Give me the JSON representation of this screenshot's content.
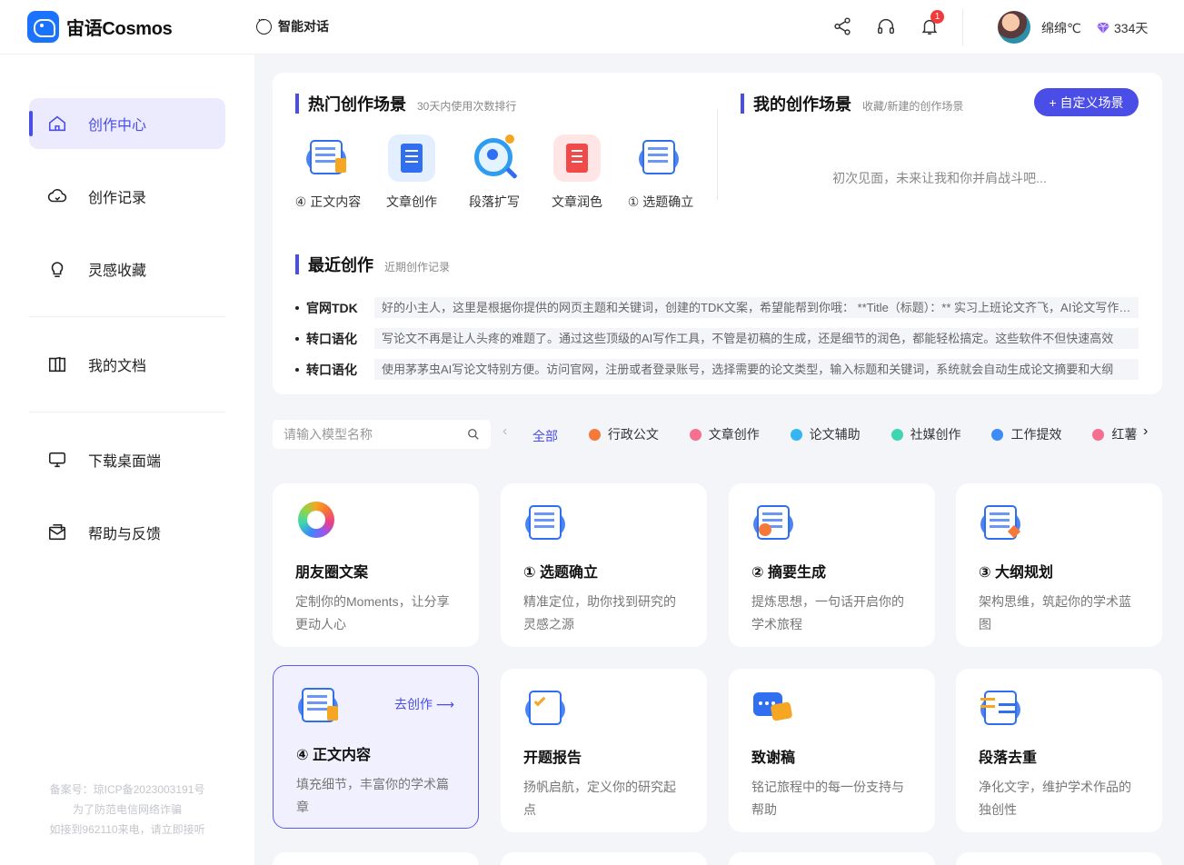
{
  "header": {
    "brand": "宙语Cosmos",
    "chat_nav": "智能对话",
    "notification_count": "1",
    "username": "绵绵℃",
    "vip_days": "334天"
  },
  "sidebar": {
    "items": [
      {
        "label": "创作中心",
        "icon": "home-icon"
      },
      {
        "label": "创作记录",
        "icon": "cloud-icon"
      },
      {
        "label": "灵感收藏",
        "icon": "bulb-icon"
      },
      {
        "label": "我的文档",
        "icon": "book-icon"
      },
      {
        "label": "下载桌面端",
        "icon": "monitor-icon"
      },
      {
        "label": "帮助与反馈",
        "icon": "mail-icon"
      }
    ],
    "footer": [
      "备案号：琼ICP备2023003191号",
      "为了防范电信网络诈骗",
      "如接到962110来电，请立即接听"
    ]
  },
  "hot": {
    "title": "热门创作场景",
    "subtitle": "30天内使用次数排行",
    "items": [
      {
        "label": "④ 正文内容"
      },
      {
        "label": "文章创作"
      },
      {
        "label": "段落扩写"
      },
      {
        "label": "文章润色"
      },
      {
        "label": "① 选题确立"
      }
    ]
  },
  "mine": {
    "title": "我的创作场景",
    "subtitle": "收藏/新建的创作场景",
    "add_label": "+ 自定义场景",
    "empty": "初次见面，未来让我和你并肩战斗吧..."
  },
  "recent": {
    "title": "最近创作",
    "subtitle": "近期创作记录",
    "rows": [
      {
        "name": "官网TDK",
        "text": "好的小主人，这里是根据你提供的网页主题和关键词，创建的TDK文案，希望能帮到你哦： **Title（标题）：** 实习上班论文齐飞，AI论文写作工具全攻略"
      },
      {
        "name": "转口语化",
        "text": "写论文不再是让人头疼的难题了。通过这些顶级的AI写作工具，不管是初稿的生成，还是细节的润色，都能轻松搞定。这些软件不但快速高效"
      },
      {
        "name": "转口语化",
        "text": "使用茅茅虫AI写论文特别方便。访问官网，注册或者登录账号，选择需要的论文类型，输入标题和关键词，系统就会自动生成论文摘要和大纲"
      }
    ]
  },
  "filter": {
    "search_placeholder": "请输入模型名称",
    "tabs": [
      {
        "label": "全部",
        "color": ""
      },
      {
        "label": "行政公文",
        "color": "#f5793b"
      },
      {
        "label": "文章创作",
        "color": "#f56f8e"
      },
      {
        "label": "论文辅助",
        "color": "#35b6f0"
      },
      {
        "label": "社媒创作",
        "color": "#3ed6b0"
      },
      {
        "label": "工作提效",
        "color": "#3b8cf5"
      },
      {
        "label": "红薯运营",
        "color": "#f56f8e"
      }
    ]
  },
  "cards": [
    {
      "title": "朋友圈文案",
      "desc": "定制你的Moments，让分享更动人心"
    },
    {
      "title": "① 选题确立",
      "desc": "精准定位，助你找到研究的灵感之源"
    },
    {
      "title": "② 摘要生成",
      "desc": "提炼思想，一句话开启你的学术旅程"
    },
    {
      "title": "③ 大纲规划",
      "desc": "架构思维，筑起你的学术蓝图"
    },
    {
      "title": "④ 正文内容",
      "desc": "填充细节，丰富你的学术篇章",
      "action": "去创作 ⟶"
    },
    {
      "title": "开题报告",
      "desc": "扬帆启航，定义你的研究起点"
    },
    {
      "title": "致谢稿",
      "desc": "铭记旅程中的每一份支持与帮助"
    },
    {
      "title": "段落去重",
      "desc": "净化文字，维护学术作品的独创性"
    }
  ]
}
